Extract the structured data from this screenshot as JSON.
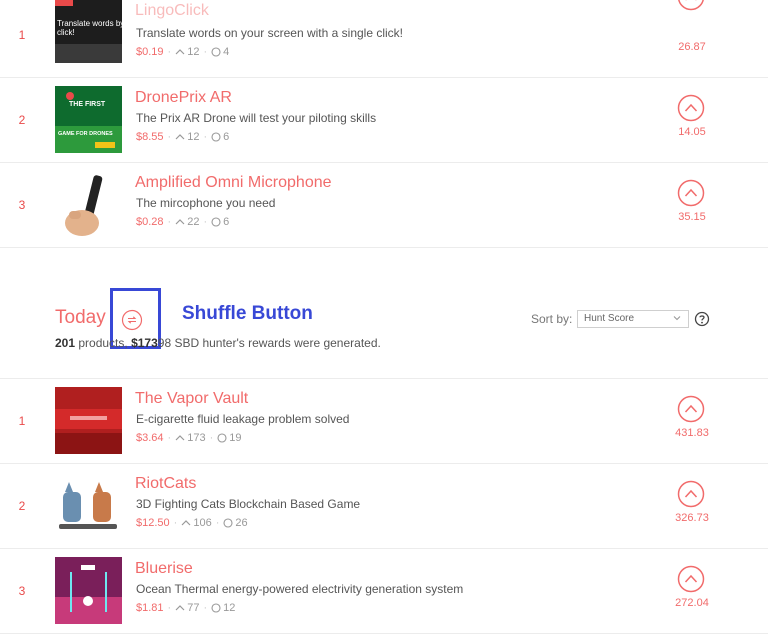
{
  "top_list": [
    {
      "rank": "1",
      "title": "LingoClick",
      "description": "Translate words on your screen with a single click!",
      "price": "$0.19",
      "upvotes": "12",
      "comments": "4",
      "score": "26.87",
      "thumb_text_1": "Translate words by m",
      "thumb_text_2": "click!"
    },
    {
      "rank": "2",
      "title": "DronePrix AR",
      "description": "The Prix AR Drone will test your piloting skills",
      "price": "$8.55",
      "upvotes": "12",
      "comments": "6",
      "score": "14.05",
      "thumb_text_1": "THE FIRST",
      "thumb_text_2": "GAME FOR DRONES"
    },
    {
      "rank": "3",
      "title": "Amplified Omni Microphone",
      "description": "The mircophone you need",
      "price": "$0.28",
      "upvotes": "22",
      "comments": "6",
      "score": "35.15"
    }
  ],
  "today": {
    "title": "Today",
    "annotation": "Shuffle Button",
    "summary_count": "201",
    "summary_mid": " products, ",
    "summary_amount": "$173",
    "summary_rest": "98 SBD hunter's rewards were generated.",
    "sort_label": "Sort by:",
    "sort_value": "Hunt Score"
  },
  "today_list": [
    {
      "rank": "1",
      "title": "The Vapor Vault",
      "description": "E-cigarette fluid leakage problem solved",
      "price": "$3.64",
      "upvotes": "173",
      "comments": "19",
      "score": "431.83"
    },
    {
      "rank": "2",
      "title": "RiotCats",
      "description": "3D Fighting Cats Blockchain Based Game",
      "price": "$12.50",
      "upvotes": "106",
      "comments": "26",
      "score": "326.73"
    },
    {
      "rank": "3",
      "title": "Bluerise",
      "description": "Ocean Thermal energy-powered electrivity generation system",
      "price": "$1.81",
      "upvotes": "77",
      "comments": "12",
      "score": "272.04"
    }
  ],
  "colors": {
    "accent": "#f16b6b",
    "annotation": "#3848d6"
  },
  "icons": [
    "upvote-icon",
    "comment-icon",
    "shuffle-icon",
    "chevron-down-icon",
    "help-icon"
  ]
}
